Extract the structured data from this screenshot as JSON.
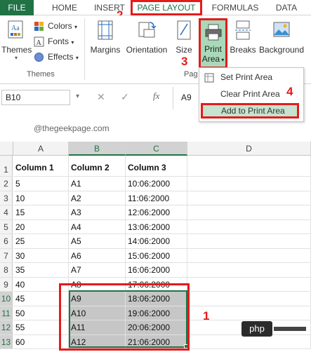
{
  "ribbon": {
    "tabs": {
      "file": "FILE",
      "home": "HOME",
      "insert": "INSERT",
      "page_layout": "PAGE LAYOUT",
      "formulas": "FORMULAS",
      "data": "DATA"
    },
    "themes_group": {
      "themes_label": "Themes",
      "colors_label": "Colors",
      "fonts_label": "Fonts",
      "effects_label": "Effects",
      "group_label": "Themes"
    },
    "page_setup": {
      "margins_label": "Margins",
      "orientation_label": "Orientation",
      "size_label": "Size",
      "print_area_label": "Print",
      "print_area_label2": "Area",
      "breaks_label": "Breaks",
      "background_label": "Background",
      "group_label_partial": "Pag"
    }
  },
  "print_area_menu": {
    "items": [
      {
        "label": "Set Print Area"
      },
      {
        "label": "Clear Print Area"
      },
      {
        "label": "Add to Print Area"
      }
    ]
  },
  "formula_bar": {
    "name_box": "B10",
    "fx_label": "fx",
    "second_cell_ref": "A9"
  },
  "watermark": "@thegeekpage.com",
  "grid": {
    "columns": [
      "A",
      "B",
      "C",
      "D"
    ],
    "rows": [
      {
        "num": "1",
        "a": "Column 1",
        "b": "Column 2",
        "c": "Column 3"
      },
      {
        "num": "2",
        "a": "5",
        "b": "A1",
        "c": "10:06:2000"
      },
      {
        "num": "3",
        "a": "10",
        "b": "A2",
        "c": "11:06:2000"
      },
      {
        "num": "4",
        "a": "15",
        "b": "A3",
        "c": "12:06:2000"
      },
      {
        "num": "5",
        "a": "20",
        "b": "A4",
        "c": "13:06:2000"
      },
      {
        "num": "6",
        "a": "25",
        "b": "A5",
        "c": "14:06:2000"
      },
      {
        "num": "7",
        "a": "30",
        "b": "A6",
        "c": "15:06:2000"
      },
      {
        "num": "8",
        "a": "35",
        "b": "A7",
        "c": "16:06:2000"
      },
      {
        "num": "9",
        "a": "40",
        "b": "A8",
        "c": "17:06:2000"
      },
      {
        "num": "10",
        "a": "45",
        "b": "A9",
        "c": "18:06:2000"
      },
      {
        "num": "11",
        "a": "50",
        "b": "A10",
        "c": "19:06:2000"
      },
      {
        "num": "12",
        "a": "55",
        "b": "A11",
        "c": "20:06:2000"
      },
      {
        "num": "13",
        "a": "60",
        "b": "A12",
        "c": "21:06:2000"
      }
    ]
  },
  "annotations": {
    "step1": "1",
    "step2": "2",
    "step3": "3",
    "step4": "4"
  },
  "badge": "php",
  "colors": {
    "excel_green": "#217346",
    "annotation_red": "#e41b1b",
    "selection_gray": "#c6c6c6",
    "highlight_green": "#a9d9b8"
  }
}
